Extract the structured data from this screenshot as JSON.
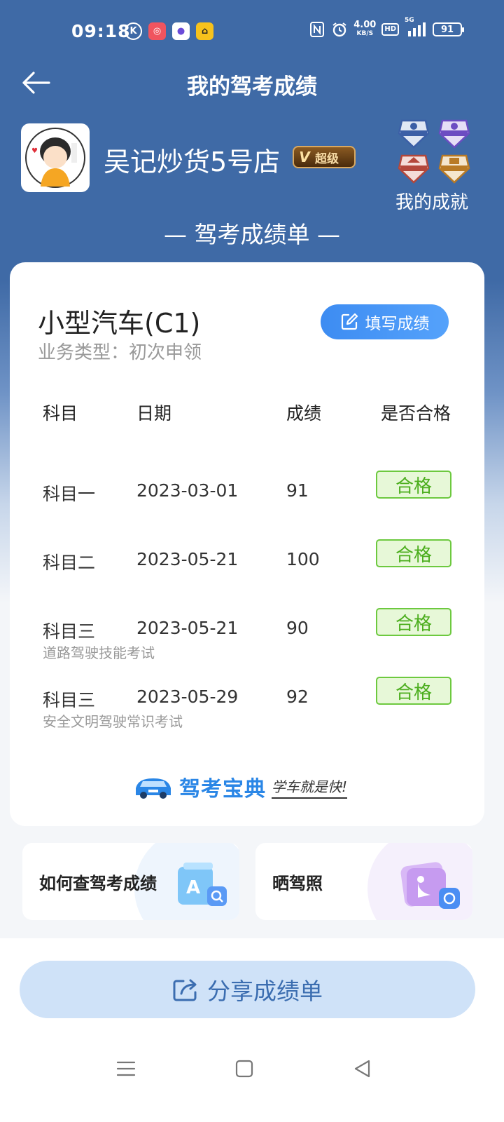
{
  "status_bar": {
    "time": "09:18",
    "net_speed": "4.00",
    "net_unit": "KB/S",
    "hd": "HD",
    "signal": "5G",
    "battery": "91"
  },
  "header": {
    "title": "我的驾考成绩"
  },
  "profile": {
    "name": "吴记炒货5号店",
    "vip_label": "超级",
    "achievements_label": "我的成就"
  },
  "sheet_title": "— 驾考成绩单 —",
  "card": {
    "car_type": "小型汽车(C1)",
    "business_type": "业务类型：初次申领",
    "fill_button": "填写成绩",
    "columns": [
      "科目",
      "日期",
      "成绩",
      "是否合格"
    ],
    "rows": [
      {
        "subject": "科目一",
        "date": "2023-03-01",
        "score": "91",
        "result": "合格",
        "note": ""
      },
      {
        "subject": "科目二",
        "date": "2023-05-21",
        "score": "100",
        "result": "合格",
        "note": ""
      },
      {
        "subject": "科目三",
        "date": "2023-05-21",
        "score": "90",
        "result": "合格",
        "note": "道路驾驶技能考试"
      },
      {
        "subject": "科目三",
        "date": "2023-05-29",
        "score": "92",
        "result": "合格",
        "note": "安全文明驾驶常识考试"
      }
    ],
    "brand_name": "驾考宝典",
    "brand_slogan": "学车就是快!"
  },
  "tiles": {
    "query_scores": "如何查驾考成绩",
    "show_license": "晒驾照"
  },
  "share_button": "分享成绩单",
  "colors": {
    "header_blue": "#3f6aa6",
    "accent_blue": "#3d8cf2",
    "pass_green": "#4cae1e"
  }
}
